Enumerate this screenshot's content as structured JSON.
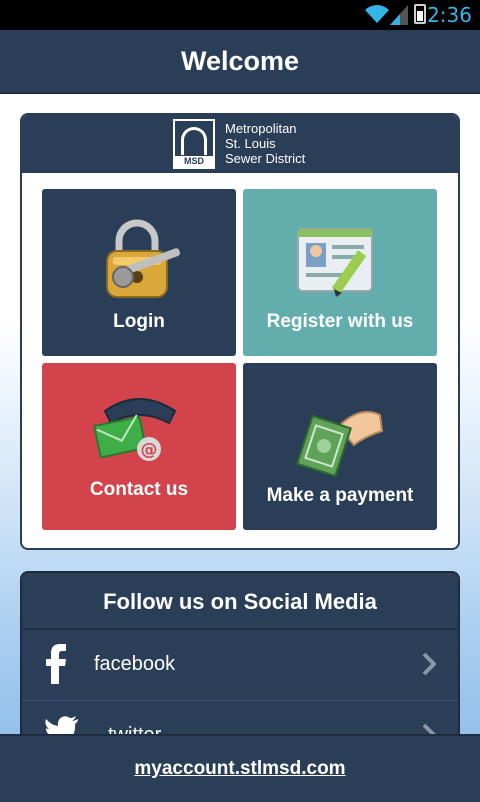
{
  "status_bar": {
    "time": "2:36"
  },
  "header": {
    "title": "Welcome"
  },
  "logo": {
    "badge_text": "MSD",
    "line1": "Metropolitan",
    "line2": "St. Louis",
    "line3": "Sewer District"
  },
  "tiles": {
    "login": "Login",
    "register": "Register with us",
    "contact": "Contact us",
    "payment": "Make a payment"
  },
  "colors": {
    "navy": "#2a3e57",
    "teal": "#63aead",
    "red": "#d3434b"
  },
  "social": {
    "title": "Follow us on Social Media",
    "items": [
      {
        "label": "facebook",
        "icon": "facebook-icon"
      },
      {
        "label": "twitter",
        "icon": "twitter-icon"
      }
    ]
  },
  "footer": {
    "link": "myaccount.stlmsd.com"
  }
}
